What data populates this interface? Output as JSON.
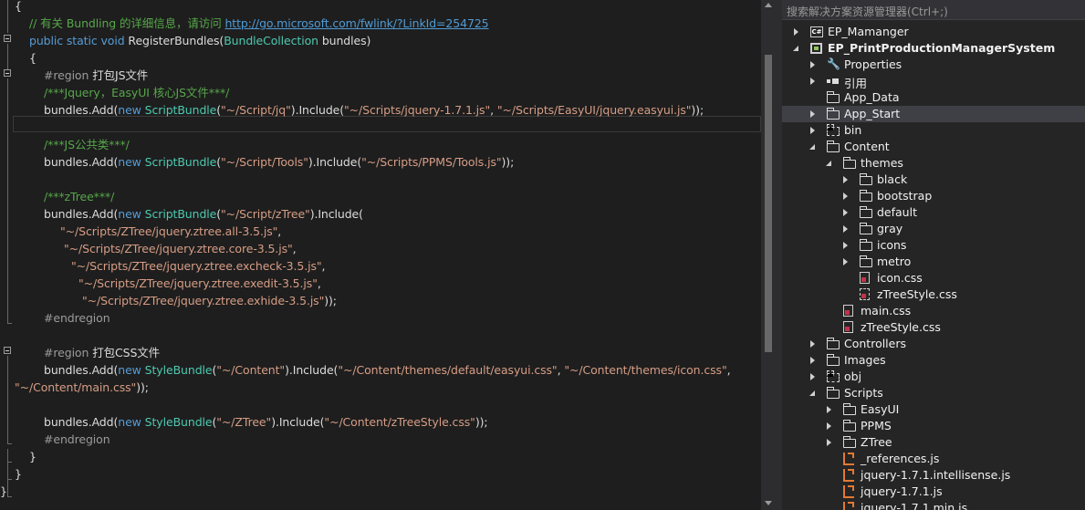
{
  "editor": {
    "lines": [
      {
        "indent": 16,
        "tokens": [
          {
            "t": "{",
            "c": "pl"
          }
        ]
      },
      {
        "indent": 32,
        "tokens": [
          {
            "t": "// 有关 Bundling 的详细信息，请访问 ",
            "c": "cm"
          },
          {
            "t": "http://go.microsoft.com/fwlink/?LinkId=254725",
            "c": "lk"
          }
        ]
      },
      {
        "indent": 32,
        "tokens": [
          {
            "t": "public ",
            "c": "kw"
          },
          {
            "t": "static ",
            "c": "kw"
          },
          {
            "t": "void ",
            "c": "kw"
          },
          {
            "t": "RegisterBundles(",
            "c": "pl"
          },
          {
            "t": "BundleCollection",
            "c": "ty"
          },
          {
            "t": " bundles)",
            "c": "pl"
          }
        ]
      },
      {
        "indent": 32,
        "tokens": [
          {
            "t": "{",
            "c": "pl"
          }
        ]
      },
      {
        "indent": 48,
        "tokens": [
          {
            "t": "#region ",
            "c": "rg"
          },
          {
            "t": "打包JS文件",
            "c": "pl"
          }
        ]
      },
      {
        "indent": 48,
        "tokens": [
          {
            "t": "/***Jquery，EasyUI 核心JS文件***/",
            "c": "cm"
          }
        ]
      },
      {
        "indent": 48,
        "tokens": [
          {
            "t": "bundles.Add(",
            "c": "pl"
          },
          {
            "t": "new ",
            "c": "kw"
          },
          {
            "t": "ScriptBundle",
            "c": "ty"
          },
          {
            "t": "(",
            "c": "pl"
          },
          {
            "t": "\"~/Script/jq\"",
            "c": "st"
          },
          {
            "t": ").Include(",
            "c": "pl"
          },
          {
            "t": "\"~/Scripts/jquery-1.7.1.js\"",
            "c": "st"
          },
          {
            "t": ", ",
            "c": "pl"
          },
          {
            "t": "\"~/Scripts/EasyUI/jquery.easyui.js\"",
            "c": "st"
          },
          {
            "t": "));",
            "c": "pl"
          }
        ]
      },
      {
        "indent": 48,
        "tokens": []
      },
      {
        "indent": 48,
        "tokens": [
          {
            "t": "/***JS公共类***/",
            "c": "cm"
          }
        ]
      },
      {
        "indent": 48,
        "tokens": [
          {
            "t": "bundles.Add(",
            "c": "pl"
          },
          {
            "t": "new ",
            "c": "kw"
          },
          {
            "t": "ScriptBundle",
            "c": "ty"
          },
          {
            "t": "(",
            "c": "pl"
          },
          {
            "t": "\"~/Script/Tools\"",
            "c": "st"
          },
          {
            "t": ").Include(",
            "c": "pl"
          },
          {
            "t": "\"~/Scripts/PPMS/Tools.js\"",
            "c": "st"
          },
          {
            "t": "));",
            "c": "pl"
          }
        ]
      },
      {
        "indent": 48,
        "tokens": []
      },
      {
        "indent": 48,
        "tokens": [
          {
            "t": "/***zTree***/",
            "c": "cm"
          }
        ]
      },
      {
        "indent": 48,
        "tokens": [
          {
            "t": "bundles.Add(",
            "c": "pl"
          },
          {
            "t": "new ",
            "c": "kw"
          },
          {
            "t": "ScriptBundle",
            "c": "ty"
          },
          {
            "t": "(",
            "c": "pl"
          },
          {
            "t": "\"~/Script/zTree\"",
            "c": "st"
          },
          {
            "t": ").Include(",
            "c": "pl"
          }
        ]
      },
      {
        "indent": 66,
        "tokens": [
          {
            "t": "\"~/Scripts/ZTree/jquery.ztree.all-3.5.js\"",
            "c": "st"
          },
          {
            "t": ",",
            "c": "pl"
          }
        ]
      },
      {
        "indent": 70,
        "tokens": [
          {
            "t": "\"~/Scripts/ZTree/jquery.ztree.core-3.5.js\"",
            "c": "st"
          },
          {
            "t": ",",
            "c": "pl"
          }
        ]
      },
      {
        "indent": 78,
        "tokens": [
          {
            "t": "\"~/Scripts/ZTree/jquery.ztree.excheck-3.5.js\"",
            "c": "st"
          },
          {
            "t": ",",
            "c": "pl"
          }
        ]
      },
      {
        "indent": 86,
        "tokens": [
          {
            "t": "\"~/Scripts/ZTree/jquery.ztree.exedit-3.5.js\"",
            "c": "st"
          },
          {
            "t": ",",
            "c": "pl"
          }
        ]
      },
      {
        "indent": 90,
        "tokens": [
          {
            "t": "\"~/Scripts/ZTree/jquery.ztree.exhide-3.5.js\"",
            "c": "st"
          },
          {
            "t": "));",
            "c": "pl"
          }
        ]
      },
      {
        "indent": 48,
        "tokens": [
          {
            "t": "#endregion",
            "c": "rg"
          }
        ]
      },
      {
        "indent": 48,
        "tokens": []
      },
      {
        "indent": 48,
        "tokens": [
          {
            "t": "#region ",
            "c": "rg"
          },
          {
            "t": "打包CSS文件",
            "c": "pl"
          }
        ]
      },
      {
        "indent": 48,
        "tokens": [
          {
            "t": "bundles.Add(",
            "c": "pl"
          },
          {
            "t": "new ",
            "c": "kw"
          },
          {
            "t": "StyleBundle",
            "c": "ty"
          },
          {
            "t": "(",
            "c": "pl"
          },
          {
            "t": "\"~/Content\"",
            "c": "st"
          },
          {
            "t": ").Include(",
            "c": "pl"
          },
          {
            "t": "\"~/Content/themes/default/easyui.css\"",
            "c": "st"
          },
          {
            "t": ", ",
            "c": "pl"
          },
          {
            "t": "\"~/Content/themes/icon.css\"",
            "c": "st"
          },
          {
            "t": ",",
            "c": "pl"
          }
        ]
      },
      {
        "indent": 16,
        "tokens": [
          {
            "t": "\"~/Content/main.css\"",
            "c": "st"
          },
          {
            "t": "));",
            "c": "pl"
          }
        ]
      },
      {
        "indent": 48,
        "tokens": []
      },
      {
        "indent": 48,
        "tokens": [
          {
            "t": "bundles.Add(",
            "c": "pl"
          },
          {
            "t": "new ",
            "c": "kw"
          },
          {
            "t": "StyleBundle",
            "c": "ty"
          },
          {
            "t": "(",
            "c": "pl"
          },
          {
            "t": "\"~/ZTree\"",
            "c": "st"
          },
          {
            "t": ").Include(",
            "c": "pl"
          },
          {
            "t": "\"~/Content/zTreeStyle.css\"",
            "c": "st"
          },
          {
            "t": "));",
            "c": "pl"
          }
        ]
      },
      {
        "indent": 48,
        "tokens": [
          {
            "t": "#endregion",
            "c": "rg"
          }
        ]
      },
      {
        "indent": 32,
        "tokens": [
          {
            "t": "}",
            "c": "pl"
          }
        ]
      },
      {
        "indent": 16,
        "tokens": [
          {
            "t": "}",
            "c": "pl"
          }
        ]
      },
      {
        "indent": 0,
        "tokens": [
          {
            "t": "}",
            "c": "pl"
          }
        ]
      }
    ]
  },
  "explorer": {
    "search_placeholder": "搜索解决方案资源管理器(Ctrl+;)",
    "items": [
      {
        "label": "EP_Mamanger",
        "icon": "csharp-project-icon",
        "depth": 0,
        "expander": "closed",
        "bold": false
      },
      {
        "label": "EP_PrintProductionManagerSystem",
        "icon": "web-project-icon",
        "depth": 0,
        "expander": "open",
        "bold": true
      },
      {
        "label": "Properties",
        "icon": "wrench-icon",
        "depth": 1,
        "expander": "closed"
      },
      {
        "label": "引用",
        "icon": "references-icon",
        "depth": 1,
        "expander": "closed"
      },
      {
        "label": "App_Data",
        "icon": "folder-icon",
        "depth": 1,
        "expander": "none"
      },
      {
        "label": "App_Start",
        "icon": "folder-icon",
        "depth": 1,
        "expander": "closed",
        "selected": true
      },
      {
        "label": "bin",
        "icon": "hidden-folder-icon",
        "depth": 1,
        "expander": "closed"
      },
      {
        "label": "Content",
        "icon": "folder-icon",
        "depth": 1,
        "expander": "open"
      },
      {
        "label": "themes",
        "icon": "folder-icon",
        "depth": 2,
        "expander": "open"
      },
      {
        "label": "black",
        "icon": "folder-icon",
        "depth": 3,
        "expander": "closed"
      },
      {
        "label": "bootstrap",
        "icon": "folder-icon",
        "depth": 3,
        "expander": "closed"
      },
      {
        "label": "default",
        "icon": "folder-icon",
        "depth": 3,
        "expander": "closed"
      },
      {
        "label": "gray",
        "icon": "folder-icon",
        "depth": 3,
        "expander": "closed"
      },
      {
        "label": "icons",
        "icon": "folder-icon",
        "depth": 3,
        "expander": "closed"
      },
      {
        "label": "metro",
        "icon": "folder-icon",
        "depth": 3,
        "expander": "closed"
      },
      {
        "label": "icon.css",
        "icon": "css-file-icon",
        "depth": 3,
        "expander": "none"
      },
      {
        "label": "zTreeStyle.css",
        "icon": "css-file-dashed-icon",
        "depth": 3,
        "expander": "none"
      },
      {
        "label": "main.css",
        "icon": "css-file-icon",
        "depth": 2,
        "expander": "none"
      },
      {
        "label": "zTreeStyle.css",
        "icon": "css-file-icon",
        "depth": 2,
        "expander": "none"
      },
      {
        "label": "Controllers",
        "icon": "folder-icon",
        "depth": 1,
        "expander": "closed"
      },
      {
        "label": "Images",
        "icon": "folder-icon",
        "depth": 1,
        "expander": "closed"
      },
      {
        "label": "obj",
        "icon": "hidden-folder-icon",
        "depth": 1,
        "expander": "closed"
      },
      {
        "label": "Scripts",
        "icon": "folder-icon",
        "depth": 1,
        "expander": "open"
      },
      {
        "label": "EasyUI",
        "icon": "folder-icon",
        "depth": 2,
        "expander": "closed"
      },
      {
        "label": "PPMS",
        "icon": "folder-icon",
        "depth": 2,
        "expander": "closed"
      },
      {
        "label": "ZTree",
        "icon": "folder-icon",
        "depth": 2,
        "expander": "closed"
      },
      {
        "label": "_references.js",
        "icon": "js-file-icon",
        "depth": 2,
        "expander": "none"
      },
      {
        "label": "jquery-1.7.1.intellisense.js",
        "icon": "js-file-icon",
        "depth": 2,
        "expander": "none"
      },
      {
        "label": "jquery-1.7.1.js",
        "icon": "js-file-icon",
        "depth": 2,
        "expander": "none"
      },
      {
        "label": "jquery-1.7.1.min.js",
        "icon": "js-file-icon",
        "depth": 2,
        "expander": "none"
      }
    ]
  }
}
